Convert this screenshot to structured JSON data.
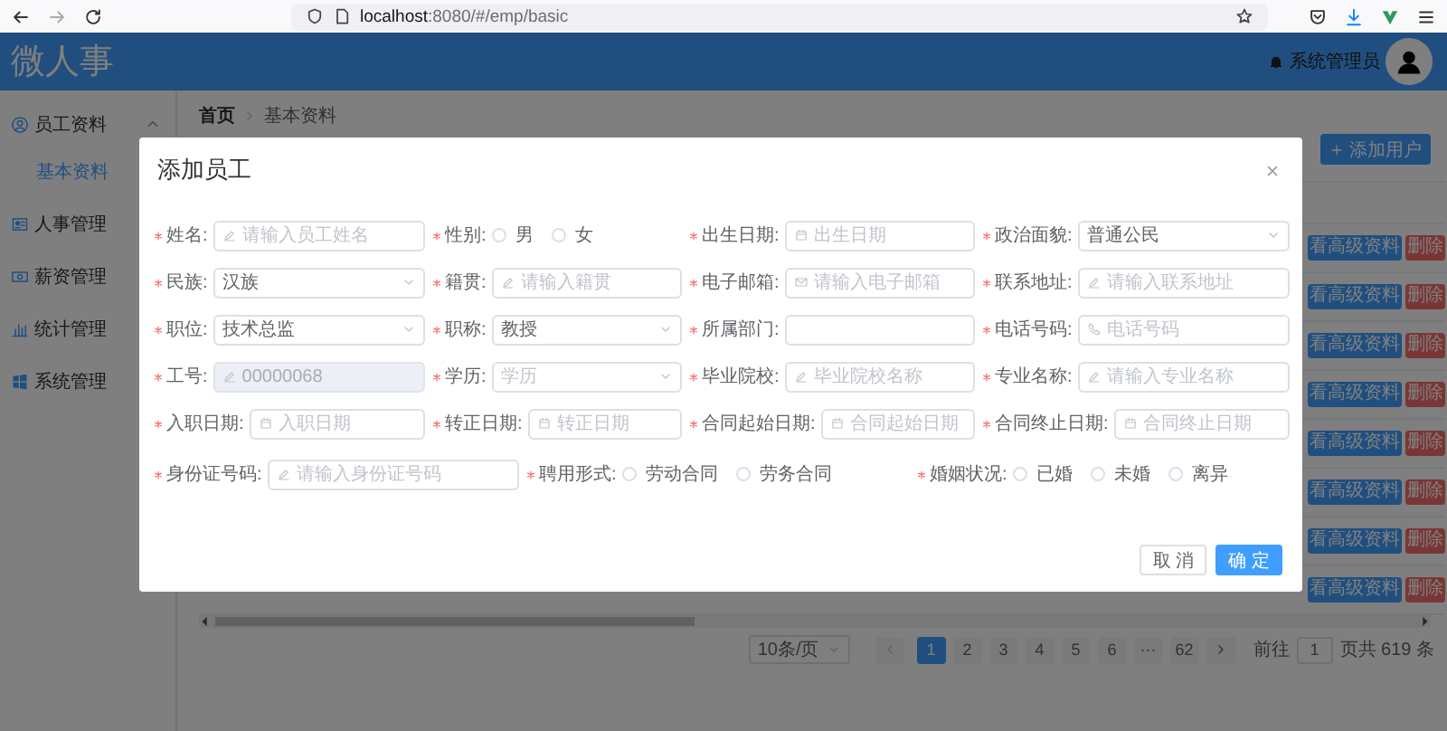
{
  "browser": {
    "url_host": "localhost",
    "url_path": ":8080/#/emp/basic"
  },
  "header": {
    "title": "微人事",
    "user": "系统管理员"
  },
  "sidebar": {
    "items": [
      {
        "label": "员工资料",
        "expanded": true,
        "children": [
          {
            "label": "基本资料",
            "selected": true
          }
        ]
      },
      {
        "label": "人事管理"
      },
      {
        "label": "薪资管理"
      },
      {
        "label": "统计管理"
      },
      {
        "label": "系统管理"
      }
    ]
  },
  "breadcrumb": [
    "首页",
    "基本资料"
  ],
  "toolbar": {
    "add_button": "添加用户"
  },
  "table": {
    "rows": [
      {
        "actions": [
          "看高级资料",
          "删除"
        ]
      },
      {
        "actions": [
          "看高级资料",
          "删除"
        ]
      },
      {
        "actions": [
          "看高级资料",
          "删除"
        ]
      },
      {
        "actions": [
          "看高级资料",
          "删除"
        ]
      },
      {
        "actions": [
          "看高级资料",
          "删除"
        ]
      },
      {
        "actions": [
          "看高级资料",
          "删除"
        ]
      },
      {
        "actions": [
          "看高级资料",
          "删除"
        ]
      },
      {
        "actions": [
          "看高级资料",
          "删除"
        ]
      }
    ]
  },
  "pagination": {
    "page_size": "10条/页",
    "pages": [
      {
        "label": "1",
        "selected": true
      },
      {
        "label": "2",
        "selected": false
      },
      {
        "label": "3",
        "selected": false
      },
      {
        "label": "4",
        "selected": false
      },
      {
        "label": "5",
        "selected": false
      },
      {
        "label": "6",
        "selected": false
      },
      {
        "label": "···",
        "selected": false
      },
      {
        "label": "62",
        "selected": false
      }
    ],
    "goto_label": "前往",
    "goto_value": "1",
    "total": "页共 619 条"
  },
  "dialog": {
    "title": "添加员工",
    "rows": [
      [
        {
          "label": "姓名:",
          "required": true,
          "kind": "text",
          "placeholder": "请输入员工姓名",
          "disabled": false
        },
        {
          "label": "性别:",
          "required": true,
          "kind": "radio",
          "options": [
            {
              "label": "男",
              "selected": false
            },
            {
              "label": "女",
              "selected": false
            }
          ]
        },
        {
          "label": "出生日期:",
          "required": true,
          "kind": "date",
          "placeholder": "出生日期",
          "disabled": false
        },
        {
          "label": "政治面貌:",
          "required": true,
          "kind": "select",
          "value": "普通公民",
          "disabled": false
        }
      ],
      [
        {
          "label": "民族:",
          "required": true,
          "kind": "select",
          "value": "汉族",
          "disabled": false
        },
        {
          "label": "籍贯:",
          "required": true,
          "kind": "text",
          "placeholder": "请输入籍贯",
          "disabled": false
        },
        {
          "label": "电子邮箱:",
          "required": true,
          "kind": "email",
          "placeholder": "请输入电子邮箱",
          "disabled": false
        },
        {
          "label": "联系地址:",
          "required": true,
          "kind": "text",
          "placeholder": "请输入联系地址",
          "disabled": false
        }
      ],
      [
        {
          "label": "职位:",
          "required": true,
          "kind": "select",
          "value": "技术总监",
          "disabled": false
        },
        {
          "label": "职称:",
          "required": true,
          "kind": "select",
          "value": "教授",
          "disabled": false
        },
        {
          "label": "所属部门:",
          "required": true,
          "kind": "plain",
          "disabled": false
        },
        {
          "label": "电话号码:",
          "required": true,
          "kind": "phone",
          "placeholder": "电话号码",
          "disabled": false
        }
      ],
      [
        {
          "label": "工号:",
          "required": true,
          "kind": "text",
          "value": "00000068",
          "disabled": true
        },
        {
          "label": "学历:",
          "required": true,
          "kind": "select",
          "placeholder": "学历",
          "disabled": false
        },
        {
          "label": "毕业院校:",
          "required": true,
          "kind": "text",
          "placeholder": "毕业院校名称",
          "disabled": false
        },
        {
          "label": "专业名称:",
          "required": true,
          "kind": "text",
          "placeholder": "请输入专业名称",
          "disabled": false
        }
      ],
      [
        {
          "label": "入职日期:",
          "required": true,
          "kind": "date",
          "placeholder": "入职日期",
          "disabled": false
        },
        {
          "label": "转正日期:",
          "required": true,
          "kind": "date",
          "placeholder": "转正日期",
          "disabled": false
        },
        {
          "label": "合同起始日期:",
          "required": true,
          "kind": "date",
          "placeholder": "合同起始日期",
          "disabled": false
        },
        {
          "label": "合同终止日期:",
          "required": true,
          "kind": "date",
          "placeholder": "合同终止日期",
          "disabled": false
        }
      ],
      [
        {
          "label": "身份证号码:",
          "required": true,
          "kind": "text",
          "placeholder": "请输入身份证号码",
          "disabled": false
        },
        {
          "label": "聘用形式:",
          "required": true,
          "kind": "radio",
          "options": [
            {
              "label": "劳动合同",
              "selected": false
            },
            {
              "label": "劳务合同",
              "selected": false
            }
          ]
        },
        {
          "label": "婚姻状况:",
          "required": true,
          "kind": "radio",
          "options": [
            {
              "label": "已婚",
              "selected": false
            },
            {
              "label": "未婚",
              "selected": false
            },
            {
              "label": "离异",
              "selected": false
            }
          ]
        }
      ]
    ],
    "buttons": [
      {
        "label": "取 消",
        "kind": "default"
      },
      {
        "label": "确 定",
        "kind": "primary"
      }
    ]
  }
}
